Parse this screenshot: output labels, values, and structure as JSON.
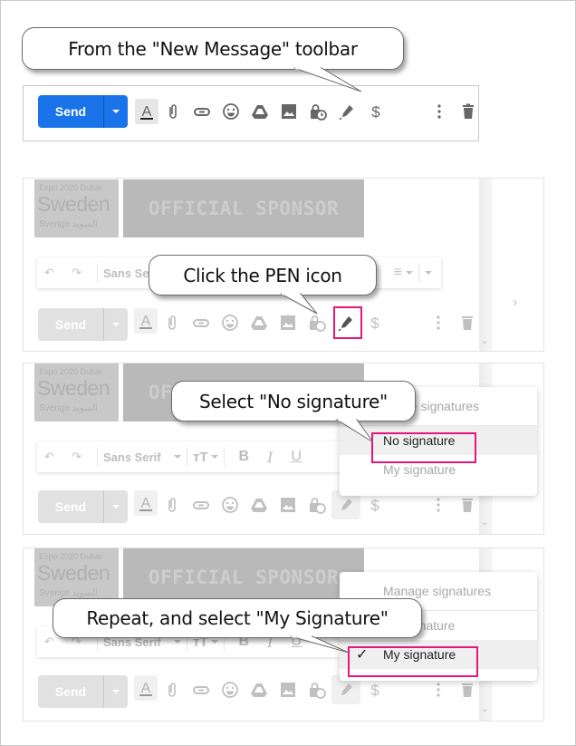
{
  "callouts": {
    "step1": "From the \"New Message\" toolbar",
    "step2": "Click the PEN icon",
    "step3": "Select \"No signature\"",
    "step4": "Repeat, and select \"My Signature\""
  },
  "toolbar": {
    "send_label": "Send",
    "icons": [
      "text-format-icon",
      "attach-icon",
      "link-icon",
      "emoji-icon",
      "drive-icon",
      "photo-icon",
      "confidential-mode-icon",
      "signature-pen-icon",
      "payment-icon",
      "more-options-icon",
      "trash-icon"
    ]
  },
  "signature_logo": {
    "line1": "Expo 2020 Dubai",
    "line2": "Sweden",
    "line3": "Sverige السويد",
    "banner": "OFFICIAL SPONSOR"
  },
  "format_bar": {
    "font": "Sans Serif",
    "font_short": "Sans Se",
    "bold": "B",
    "italic": "I",
    "underline": "U"
  },
  "signature_menu": {
    "manage": "Manage signatures",
    "manage_partial": "ge signatures",
    "no_signature": "No signature",
    "my_signature": "My signature",
    "check": "✓"
  },
  "colors": {
    "send_blue": "#1a73e8",
    "highlight_pink": "#e5177d"
  }
}
